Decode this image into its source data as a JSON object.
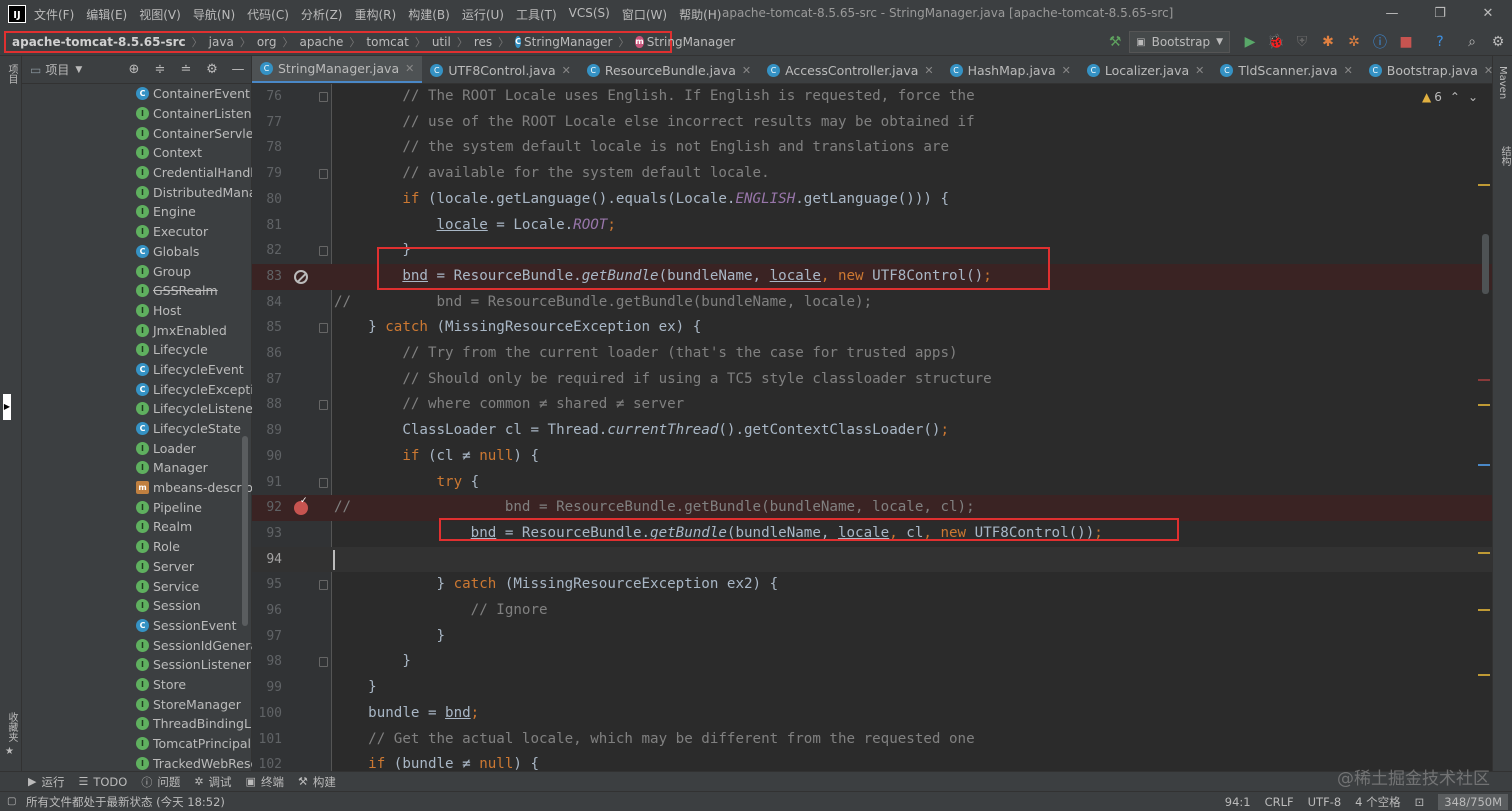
{
  "menu": {
    "items": [
      "文件(F)",
      "编辑(E)",
      "视图(V)",
      "导航(N)",
      "代码(C)",
      "分析(Z)",
      "重构(R)",
      "构建(B)",
      "运行(U)",
      "工具(T)",
      "VCS(S)",
      "窗口(W)",
      "帮助(H)"
    ],
    "window_title": "apache-tomcat-8.5.65-src - StringManager.java [apache-tomcat-8.5.65-src]"
  },
  "breadcrumb": {
    "items": [
      "apache-tomcat-8.5.65-src",
      "java",
      "org",
      "apache",
      "tomcat",
      "util",
      "res"
    ],
    "class_item": "StringManager",
    "method_item": "StringManager"
  },
  "toolbar": {
    "run_config": "Bootstrap"
  },
  "left_stripe": {
    "project_label": "项目",
    "favorites_label": "收藏夹"
  },
  "right_stripe": {
    "maven_label": "Maven",
    "structure_label": "结构"
  },
  "project_panel": {
    "title": "项目",
    "tree": [
      {
        "label": "ContainerEvent",
        "icon": "class"
      },
      {
        "label": "ContainerListener",
        "icon": "interface"
      },
      {
        "label": "ContainerServlet",
        "icon": "interface"
      },
      {
        "label": "Context",
        "icon": "interface"
      },
      {
        "label": "CredentialHandler",
        "icon": "interface"
      },
      {
        "label": "DistributedManager",
        "icon": "interface"
      },
      {
        "label": "Engine",
        "icon": "interface"
      },
      {
        "label": "Executor",
        "icon": "interface"
      },
      {
        "label": "Globals",
        "icon": "class"
      },
      {
        "label": "Group",
        "icon": "interface"
      },
      {
        "label": "GSSRealm",
        "icon": "interface",
        "deprecated": true
      },
      {
        "label": "Host",
        "icon": "interface"
      },
      {
        "label": "JmxEnabled",
        "icon": "interface"
      },
      {
        "label": "Lifecycle",
        "icon": "interface"
      },
      {
        "label": "LifecycleEvent",
        "icon": "class"
      },
      {
        "label": "LifecycleException",
        "icon": "class"
      },
      {
        "label": "LifecycleListener",
        "icon": "interface"
      },
      {
        "label": "LifecycleState",
        "icon": "class"
      },
      {
        "label": "Loader",
        "icon": "interface"
      },
      {
        "label": "Manager",
        "icon": "interface"
      },
      {
        "label": "mbeans-descriptors",
        "icon": "file"
      },
      {
        "label": "Pipeline",
        "icon": "interface"
      },
      {
        "label": "Realm",
        "icon": "interface"
      },
      {
        "label": "Role",
        "icon": "interface"
      },
      {
        "label": "Server",
        "icon": "interface"
      },
      {
        "label": "Service",
        "icon": "interface"
      },
      {
        "label": "Session",
        "icon": "interface"
      },
      {
        "label": "SessionEvent",
        "icon": "class"
      },
      {
        "label": "SessionIdGenerator",
        "icon": "interface"
      },
      {
        "label": "SessionListener",
        "icon": "interface"
      },
      {
        "label": "Store",
        "icon": "interface"
      },
      {
        "label": "StoreManager",
        "icon": "interface"
      },
      {
        "label": "ThreadBindingListener",
        "icon": "interface"
      },
      {
        "label": "TomcatPrincipal",
        "icon": "interface"
      },
      {
        "label": "TrackedWebResource",
        "icon": "interface"
      }
    ]
  },
  "tabs": [
    {
      "label": "StringManager.java",
      "active": true
    },
    {
      "label": "UTF8Control.java"
    },
    {
      "label": "ResourceBundle.java"
    },
    {
      "label": "AccessController.java"
    },
    {
      "label": "HashMap.java"
    },
    {
      "label": "Localizer.java"
    },
    {
      "label": "TldScanner.java"
    },
    {
      "label": "Bootstrap.java"
    },
    {
      "label": "V"
    }
  ],
  "inspection": {
    "warnings": "6"
  },
  "editor": {
    "lines": [
      {
        "n": "76",
        "t": [
          [
            "com",
            "        // The ROOT Locale uses English. If English is requested, force the"
          ]
        ]
      },
      {
        "n": "77",
        "t": [
          [
            "com",
            "        // use of the ROOT Locale else incorrect results may be obtained if"
          ]
        ]
      },
      {
        "n": "78",
        "t": [
          [
            "com",
            "        // the system default locale is not English and translations are"
          ]
        ]
      },
      {
        "n": "79",
        "t": [
          [
            "com",
            "        // available for the system default locale."
          ]
        ]
      },
      {
        "n": "80",
        "t": [
          [
            "kw",
            "        if"
          ],
          [
            "",
            " (locale.getLanguage().equals(Locale."
          ],
          [
            "it",
            "ENGLISH"
          ],
          [
            "",
            ".getLanguage())) {"
          ]
        ]
      },
      {
        "n": "81",
        "t": [
          [
            "",
            "            "
          ],
          [
            "u",
            "locale"
          ],
          [
            "",
            " = Locale."
          ],
          [
            "it",
            "ROOT"
          ],
          [
            "kw",
            ";"
          ]
        ]
      },
      {
        "n": "82",
        "t": [
          [
            "",
            "        }"
          ]
        ]
      },
      {
        "n": "83",
        "t": [
          [
            "",
            "        "
          ],
          [
            "u",
            "bnd"
          ],
          [
            "",
            " = ResourceBundle."
          ],
          [
            "fn",
            "getBundle"
          ],
          [
            "",
            "(bundleName, "
          ],
          [
            "u",
            "locale"
          ],
          [
            "kw",
            ", new"
          ],
          [
            "",
            " UTF8Control()"
          ],
          [
            "kw",
            ";"
          ]
        ]
      },
      {
        "n": "84",
        "t": [
          [
            "com",
            "//          bnd = ResourceBundle.getBundle(bundleName, locale);"
          ]
        ]
      },
      {
        "n": "85",
        "t": [
          [
            "",
            "    } "
          ],
          [
            "kw",
            "catch"
          ],
          [
            "",
            " (MissingResourceException ex) {"
          ]
        ]
      },
      {
        "n": "86",
        "t": [
          [
            "com",
            "        // Try from the current loader (that's the case for trusted apps)"
          ]
        ]
      },
      {
        "n": "87",
        "t": [
          [
            "com",
            "        // Should only be required if using a TC5 style classloader structure"
          ]
        ]
      },
      {
        "n": "88",
        "t": [
          [
            "com",
            "        // where common ≠ shared ≠ server"
          ]
        ]
      },
      {
        "n": "89",
        "t": [
          [
            "",
            "        ClassLoader cl = Thread."
          ],
          [
            "fn",
            "currentThread"
          ],
          [
            "",
            "().getContextClassLoader()"
          ],
          [
            "kw",
            ";"
          ]
        ]
      },
      {
        "n": "90",
        "t": [
          [
            "kw",
            "        if"
          ],
          [
            "",
            " (cl ≠ "
          ],
          [
            "kw",
            "null"
          ],
          [
            "",
            ") {"
          ]
        ]
      },
      {
        "n": "91",
        "t": [
          [
            "kw",
            "            try"
          ],
          [
            "",
            " {"
          ]
        ]
      },
      {
        "n": "92",
        "t": [
          [
            "com",
            "//                  bnd = ResourceBundle.getBundle(bundleName, locale, cl);"
          ]
        ]
      },
      {
        "n": "93",
        "t": [
          [
            "",
            "                "
          ],
          [
            "u",
            "bnd"
          ],
          [
            "",
            " = ResourceBundle."
          ],
          [
            "fn",
            "getBundle"
          ],
          [
            "",
            "(bundleName, "
          ],
          [
            "u",
            "locale"
          ],
          [
            "kw",
            ","
          ],
          [
            "",
            " cl"
          ],
          [
            "kw",
            ", new"
          ],
          [
            "",
            " UTF8Control())"
          ],
          [
            "kw",
            ";"
          ]
        ]
      },
      {
        "n": "94",
        "t": [
          [
            "",
            ""
          ]
        ]
      },
      {
        "n": "95",
        "t": [
          [
            "",
            "            } "
          ],
          [
            "kw",
            "catch"
          ],
          [
            "",
            " (MissingResourceException ex2) {"
          ]
        ]
      },
      {
        "n": "96",
        "t": [
          [
            "com",
            "                // Ignore"
          ]
        ]
      },
      {
        "n": "97",
        "t": [
          [
            "",
            "            }"
          ]
        ]
      },
      {
        "n": "98",
        "t": [
          [
            "",
            "        }"
          ]
        ]
      },
      {
        "n": "99",
        "t": [
          [
            "",
            "    }"
          ]
        ]
      },
      {
        "n": "100",
        "t": [
          [
            "",
            "    bundle = "
          ],
          [
            "u",
            "bnd"
          ],
          [
            "kw",
            ";"
          ]
        ]
      },
      {
        "n": "101",
        "t": [
          [
            "com",
            "    // Get the actual locale, which may be different from the requested one"
          ]
        ]
      },
      {
        "n": "102",
        "t": [
          [
            "kw",
            "    if"
          ],
          [
            "",
            " (bundle ≠ "
          ],
          [
            "kw",
            "null"
          ],
          [
            "",
            ") {"
          ]
        ]
      }
    ]
  },
  "bottom_tools": [
    "运行",
    "TODO",
    "问题",
    "调试",
    "终端",
    "构建"
  ],
  "watermark": "@稀土掘金技术社区",
  "status": {
    "message": "所有文件都处于最新状态 (今天 18:52)",
    "position": "94:1",
    "line_sep": "CRLF",
    "encoding": "UTF-8",
    "indent": "4 个空格",
    "memory": "348/750M"
  }
}
